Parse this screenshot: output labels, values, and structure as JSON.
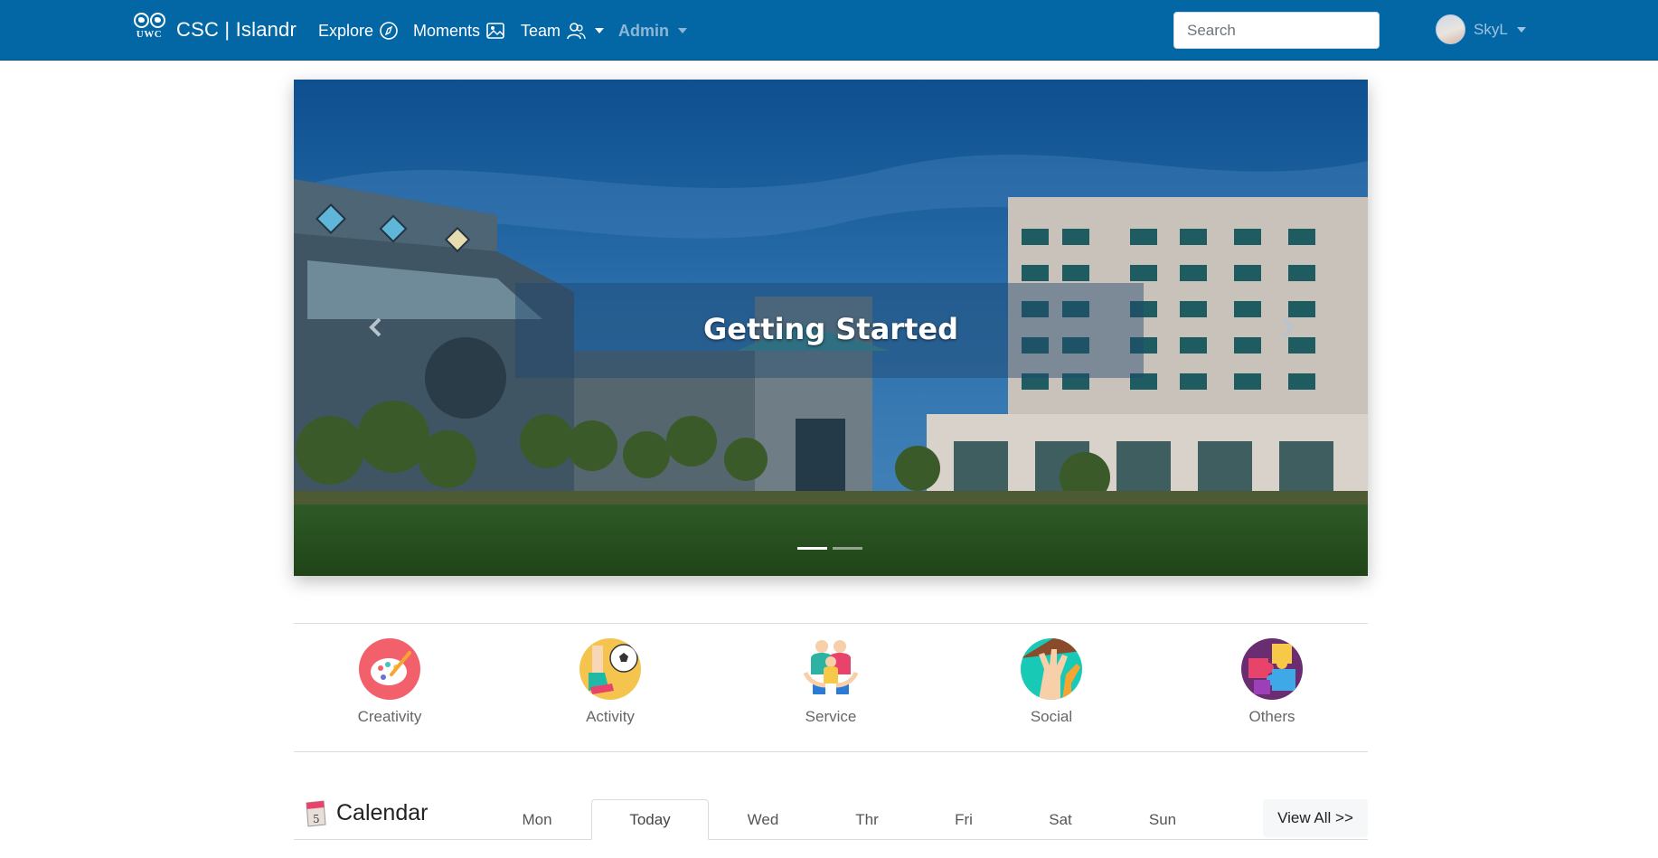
{
  "nav": {
    "brand_mark": "UWC",
    "brand": "CSC | Islandr",
    "explore": "Explore",
    "moments": "Moments",
    "team": "Team",
    "admin": "Admin",
    "search_placeholder": "Search",
    "user": "SkyL"
  },
  "carousel": {
    "caption": "Getting Started",
    "slides": 2,
    "active_slide": 1
  },
  "categories": [
    {
      "label": "Creativity",
      "icon": "palette-icon"
    },
    {
      "label": "Activity",
      "icon": "soccer-icon"
    },
    {
      "label": "Service",
      "icon": "people-icon"
    },
    {
      "label": "Social",
      "icon": "hands-icon"
    },
    {
      "label": "Others",
      "icon": "puzzle-icon"
    }
  ],
  "calendar": {
    "title": "Calendar",
    "tabs": [
      "Mon",
      "Today",
      "Wed",
      "Thr",
      "Fri",
      "Sat",
      "Sun"
    ],
    "active_tab": "Today",
    "view_all": "View All >>"
  },
  "colors": {
    "navbar": "#0367a6",
    "admin_text": "#8eb7d6"
  }
}
